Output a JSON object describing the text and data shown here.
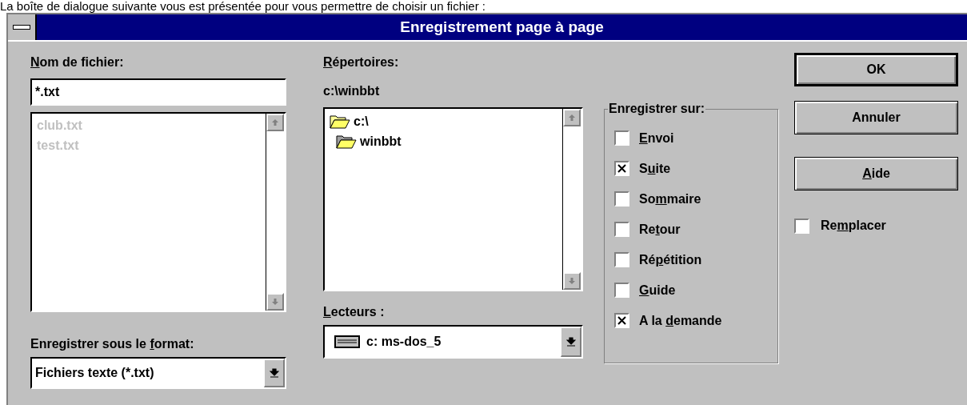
{
  "intro": "La boîte de dialogue suivante vous est présentée pour vous permettre de choisir un fichier :",
  "window": {
    "title": "Enregistrement page à page"
  },
  "filename": {
    "label": {
      "key": "N",
      "post": "om de fichier:"
    },
    "value": "*.txt",
    "files": [
      {
        "name": "club.txt",
        "disabled": true
      },
      {
        "name": "test.txt",
        "disabled": true
      }
    ]
  },
  "format": {
    "label": {
      "pre": "Enregistrer sous le ",
      "key": "f",
      "post": "ormat:"
    },
    "value": "Fichiers texte (*.txt)"
  },
  "directories": {
    "label": {
      "key": "R",
      "post": "épertoires:"
    },
    "path": "c:\\winbbt",
    "tree": [
      {
        "name": "c:\\",
        "expanded": true,
        "children": [
          {
            "name": "winbbt",
            "selected": true
          }
        ]
      }
    ]
  },
  "drives": {
    "label": {
      "key": "L",
      "post": "ecteurs :"
    },
    "value": "c: ms-dos_5"
  },
  "save_to": {
    "title": "Enregistrer sur:",
    "options": [
      {
        "label": {
          "key": "E",
          "post": "nvoi"
        },
        "checked": false
      },
      {
        "label": {
          "pre": "S",
          "key": "u",
          "post": "ite"
        },
        "checked": true
      },
      {
        "label": {
          "pre": "So",
          "key": "m",
          "post": "maire"
        },
        "checked": false
      },
      {
        "label": {
          "pre": "Re",
          "key": "t",
          "post": "our"
        },
        "checked": false
      },
      {
        "label": {
          "pre": "Ré",
          "key": "p",
          "post": "étition"
        },
        "checked": false
      },
      {
        "label": {
          "key": "G",
          "post": "uide"
        },
        "checked": false
      },
      {
        "label": {
          "pre": "A la ",
          "key": "d",
          "post": "emande"
        },
        "checked": true
      }
    ]
  },
  "buttons": [
    {
      "label": {
        "pre": "OK"
      },
      "default": true
    },
    {
      "label": {
        "pre": "Annuler"
      },
      "default": false
    },
    {
      "label": {
        "key": "A",
        "post": "ide"
      },
      "default": false
    }
  ],
  "replace": {
    "label": {
      "pre": "Re",
      "key": "m",
      "post": "placer"
    },
    "checked": false
  }
}
